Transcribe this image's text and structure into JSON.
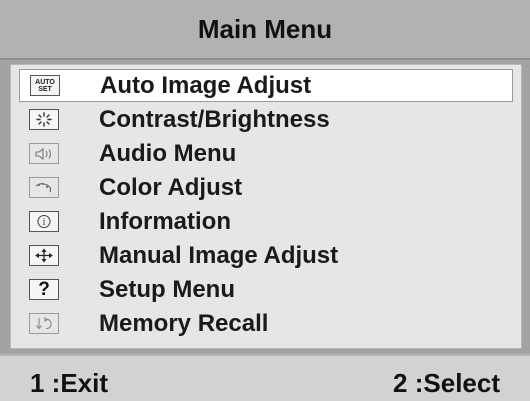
{
  "menu": {
    "title": "Main Menu",
    "items": [
      {
        "label": "Auto Image Adjust",
        "icon": "auto-set-icon",
        "icon_text": [
          "AUTO",
          "SET"
        ],
        "selected": true
      },
      {
        "label": "Contrast/Brightness",
        "icon": "brightness-icon",
        "selected": false
      },
      {
        "label": "Audio Menu",
        "icon": "speaker-icon",
        "selected": false
      },
      {
        "label": "Color Adjust",
        "icon": "color-palette-icon",
        "selected": false
      },
      {
        "label": "Information",
        "icon": "info-icon",
        "selected": false
      },
      {
        "label": "Manual Image Adjust",
        "icon": "move-arrows-icon",
        "selected": false
      },
      {
        "label": "Setup Menu",
        "icon": "question-icon",
        "icon_text": "?",
        "selected": false
      },
      {
        "label": "Memory Recall",
        "icon": "recall-icon",
        "selected": false
      }
    ]
  },
  "footer": {
    "exit_label": "1 :Exit",
    "select_label": "2 :Select"
  },
  "colors": {
    "background": "#a3a3a3",
    "panel": "#e6e6e6",
    "selected_row": "#ffffff",
    "text": "#1a1a1a"
  }
}
